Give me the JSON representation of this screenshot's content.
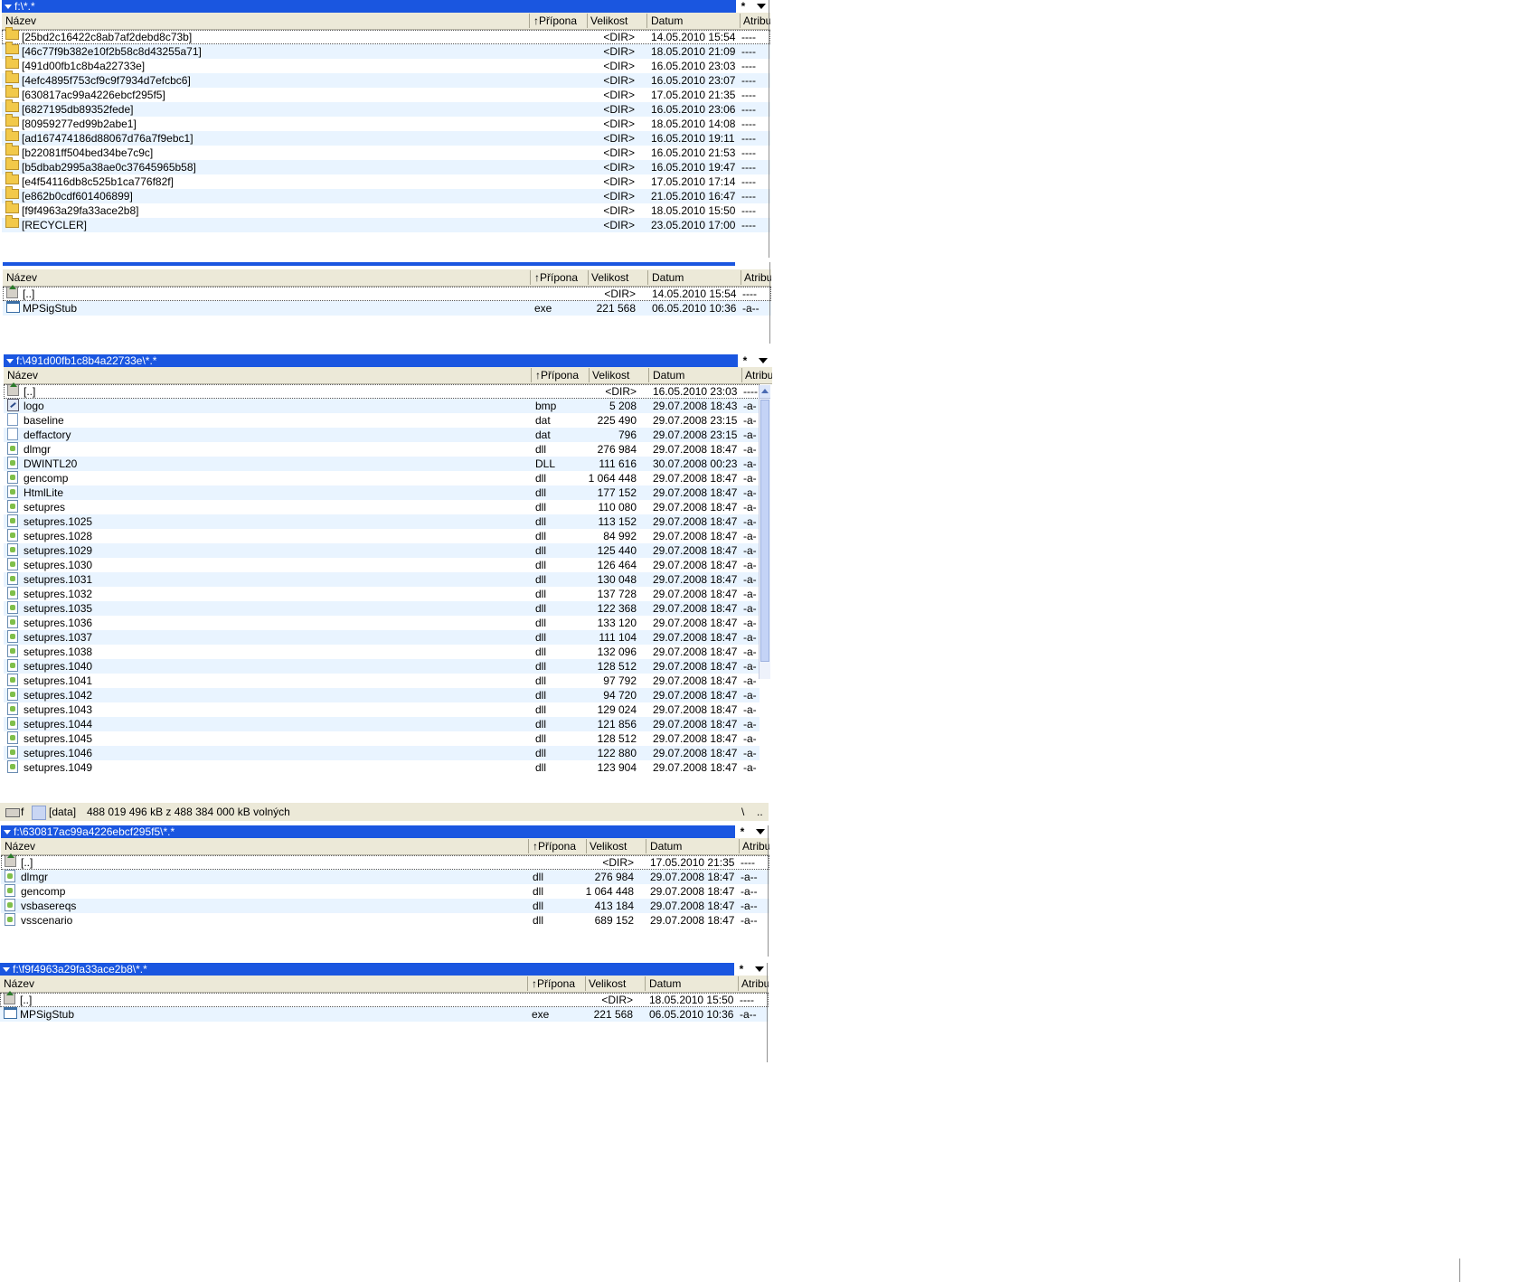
{
  "columns": {
    "name": "Název",
    "ext": "Přípona",
    "size": "Velikost",
    "date": "Datum",
    "attr": "Atribu"
  },
  "sort_indicator": "↑",
  "panel1": {
    "path": "f:\\*.*",
    "star": "*",
    "rows": [
      {
        "name": "[25bd2c16422c8ab7af2debd8c73b]",
        "ext": "",
        "size": "<DIR>",
        "date": "14.05.2010 15:54",
        "attr": "----",
        "icon": "folder-icon"
      },
      {
        "name": "[46c77f9b382e10f2b58c8d43255a71]",
        "ext": "",
        "size": "<DIR>",
        "date": "18.05.2010 21:09",
        "attr": "----",
        "icon": "folder-icon"
      },
      {
        "name": "[491d00fb1c8b4a22733e]",
        "ext": "",
        "size": "<DIR>",
        "date": "16.05.2010 23:03",
        "attr": "----",
        "icon": "folder-icon"
      },
      {
        "name": "[4efc4895f753cf9c9f7934d7efcbc6]",
        "ext": "",
        "size": "<DIR>",
        "date": "16.05.2010 23:07",
        "attr": "----",
        "icon": "folder-icon"
      },
      {
        "name": "[630817ac99a4226ebcf295f5]",
        "ext": "",
        "size": "<DIR>",
        "date": "17.05.2010 21:35",
        "attr": "----",
        "icon": "folder-icon"
      },
      {
        "name": "[6827195db89352fede]",
        "ext": "",
        "size": "<DIR>",
        "date": "16.05.2010 23:06",
        "attr": "----",
        "icon": "folder-icon"
      },
      {
        "name": "[80959277ed99b2abe1]",
        "ext": "",
        "size": "<DIR>",
        "date": "18.05.2010 14:08",
        "attr": "----",
        "icon": "folder-icon"
      },
      {
        "name": "[ad167474186d88067d76a7f9ebc1]",
        "ext": "",
        "size": "<DIR>",
        "date": "16.05.2010 19:11",
        "attr": "----",
        "icon": "folder-icon"
      },
      {
        "name": "[b22081ff504bed34be7c9c]",
        "ext": "",
        "size": "<DIR>",
        "date": "16.05.2010 21:53",
        "attr": "----",
        "icon": "folder-icon"
      },
      {
        "name": "[b5dbab2995a38ae0c37645965b58]",
        "ext": "",
        "size": "<DIR>",
        "date": "16.05.2010 19:47",
        "attr": "----",
        "icon": "folder-icon"
      },
      {
        "name": "[e4f54116db8c525b1ca776f82f]",
        "ext": "",
        "size": "<DIR>",
        "date": "17.05.2010 17:14",
        "attr": "----",
        "icon": "folder-icon"
      },
      {
        "name": "[e862b0cdf601406899]",
        "ext": "",
        "size": "<DIR>",
        "date": "21.05.2010 16:47",
        "attr": "----",
        "icon": "folder-icon"
      },
      {
        "name": "[f9f4963a29fa33ace2b8]",
        "ext": "",
        "size": "<DIR>",
        "date": "18.05.2010 15:50",
        "attr": "----",
        "icon": "folder-icon"
      },
      {
        "name": "[RECYCLER]",
        "ext": "",
        "size": "<DIR>",
        "date": "23.05.2010 17:00",
        "attr": "----",
        "icon": "folder-icon"
      }
    ]
  },
  "panel2": {
    "rows": [
      {
        "name": "[..]",
        "ext": "",
        "size": "<DIR>",
        "date": "14.05.2010 15:54",
        "attr": "----",
        "icon": "up-dir-icon"
      },
      {
        "name": "MPSigStub",
        "ext": "exe",
        "size": "221 568",
        "date": "06.05.2010 10:36",
        "attr": "-a--",
        "icon": "exe-icon"
      }
    ]
  },
  "panel3": {
    "path": "f:\\491d00fb1c8b4a22733e\\*.*",
    "star": "*",
    "rows": [
      {
        "name": "[..]",
        "ext": "",
        "size": "<DIR>",
        "date": "16.05.2010 23:03",
        "attr": "----",
        "icon": "up-dir-icon"
      },
      {
        "name": "logo",
        "ext": "bmp",
        "size": "5 208",
        "date": "29.07.2008 18:43",
        "attr": "-a-",
        "icon": "bmp-icon"
      },
      {
        "name": "baseline",
        "ext": "dat",
        "size": "225 490",
        "date": "29.07.2008 23:15",
        "attr": "-a-",
        "icon": "doc-icon"
      },
      {
        "name": "deffactory",
        "ext": "dat",
        "size": "796",
        "date": "29.07.2008 23:15",
        "attr": "-a-",
        "icon": "doc-icon"
      },
      {
        "name": "dlmgr",
        "ext": "dll",
        "size": "276 984",
        "date": "29.07.2008 18:47",
        "attr": "-a-",
        "icon": "dll-icon"
      },
      {
        "name": "DWINTL20",
        "ext": "DLL",
        "size": "111 616",
        "date": "30.07.2008 00:23",
        "attr": "-a-",
        "icon": "dll-icon"
      },
      {
        "name": "gencomp",
        "ext": "dll",
        "size": "1 064 448",
        "date": "29.07.2008 18:47",
        "attr": "-a-",
        "icon": "dll-icon"
      },
      {
        "name": "HtmlLite",
        "ext": "dll",
        "size": "177 152",
        "date": "29.07.2008 18:47",
        "attr": "-a-",
        "icon": "dll-icon"
      },
      {
        "name": "setupres",
        "ext": "dll",
        "size": "110 080",
        "date": "29.07.2008 18:47",
        "attr": "-a-",
        "icon": "dll-icon"
      },
      {
        "name": "setupres.1025",
        "ext": "dll",
        "size": "113 152",
        "date": "29.07.2008 18:47",
        "attr": "-a-",
        "icon": "dll-icon"
      },
      {
        "name": "setupres.1028",
        "ext": "dll",
        "size": "84 992",
        "date": "29.07.2008 18:47",
        "attr": "-a-",
        "icon": "dll-icon"
      },
      {
        "name": "setupres.1029",
        "ext": "dll",
        "size": "125 440",
        "date": "29.07.2008 18:47",
        "attr": "-a-",
        "icon": "dll-icon"
      },
      {
        "name": "setupres.1030",
        "ext": "dll",
        "size": "126 464",
        "date": "29.07.2008 18:47",
        "attr": "-a-",
        "icon": "dll-icon"
      },
      {
        "name": "setupres.1031",
        "ext": "dll",
        "size": "130 048",
        "date": "29.07.2008 18:47",
        "attr": "-a-",
        "icon": "dll-icon"
      },
      {
        "name": "setupres.1032",
        "ext": "dll",
        "size": "137 728",
        "date": "29.07.2008 18:47",
        "attr": "-a-",
        "icon": "dll-icon"
      },
      {
        "name": "setupres.1035",
        "ext": "dll",
        "size": "122 368",
        "date": "29.07.2008 18:47",
        "attr": "-a-",
        "icon": "dll-icon"
      },
      {
        "name": "setupres.1036",
        "ext": "dll",
        "size": "133 120",
        "date": "29.07.2008 18:47",
        "attr": "-a-",
        "icon": "dll-icon"
      },
      {
        "name": "setupres.1037",
        "ext": "dll",
        "size": "111 104",
        "date": "29.07.2008 18:47",
        "attr": "-a-",
        "icon": "dll-icon"
      },
      {
        "name": "setupres.1038",
        "ext": "dll",
        "size": "132 096",
        "date": "29.07.2008 18:47",
        "attr": "-a-",
        "icon": "dll-icon"
      },
      {
        "name": "setupres.1040",
        "ext": "dll",
        "size": "128 512",
        "date": "29.07.2008 18:47",
        "attr": "-a-",
        "icon": "dll-icon"
      },
      {
        "name": "setupres.1041",
        "ext": "dll",
        "size": "97 792",
        "date": "29.07.2008 18:47",
        "attr": "-a-",
        "icon": "dll-icon"
      },
      {
        "name": "setupres.1042",
        "ext": "dll",
        "size": "94 720",
        "date": "29.07.2008 18:47",
        "attr": "-a-",
        "icon": "dll-icon"
      },
      {
        "name": "setupres.1043",
        "ext": "dll",
        "size": "129 024",
        "date": "29.07.2008 18:47",
        "attr": "-a-",
        "icon": "dll-icon"
      },
      {
        "name": "setupres.1044",
        "ext": "dll",
        "size": "121 856",
        "date": "29.07.2008 18:47",
        "attr": "-a-",
        "icon": "dll-icon"
      },
      {
        "name": "setupres.1045",
        "ext": "dll",
        "size": "128 512",
        "date": "29.07.2008 18:47",
        "attr": "-a-",
        "icon": "dll-icon"
      },
      {
        "name": "setupres.1046",
        "ext": "dll",
        "size": "122 880",
        "date": "29.07.2008 18:47",
        "attr": "-a-",
        "icon": "dll-icon"
      },
      {
        "name": "setupres.1049",
        "ext": "dll",
        "size": "123 904",
        "date": "29.07.2008 18:47",
        "attr": "-a-",
        "icon": "dll-icon"
      }
    ]
  },
  "drivebar": {
    "drive_letter": "f",
    "label": "[data]",
    "free_text": "488 019 496 kB z 488 384 000 kB volných",
    "root_btn": "\\",
    "up_btn": ".."
  },
  "panel4": {
    "path": "f:\\630817ac99a4226ebcf295f5\\*.*",
    "star": "*",
    "rows": [
      {
        "name": "[..]",
        "ext": "",
        "size": "<DIR>",
        "date": "17.05.2010 21:35",
        "attr": "----",
        "icon": "up-dir-icon"
      },
      {
        "name": "dlmgr",
        "ext": "dll",
        "size": "276 984",
        "date": "29.07.2008 18:47",
        "attr": "-a--",
        "icon": "dll-icon"
      },
      {
        "name": "gencomp",
        "ext": "dll",
        "size": "1 064 448",
        "date": "29.07.2008 18:47",
        "attr": "-a--",
        "icon": "dll-icon"
      },
      {
        "name": "vsbasereqs",
        "ext": "dll",
        "size": "413 184",
        "date": "29.07.2008 18:47",
        "attr": "-a--",
        "icon": "dll-icon"
      },
      {
        "name": "vsscenario",
        "ext": "dll",
        "size": "689 152",
        "date": "29.07.2008 18:47",
        "attr": "-a--",
        "icon": "dll-icon"
      }
    ]
  },
  "panel5": {
    "path": "f:\\f9f4963a29fa33ace2b8\\*.*",
    "star": "*",
    "rows": [
      {
        "name": "[..]",
        "ext": "",
        "size": "<DIR>",
        "date": "18.05.2010 15:50",
        "attr": "----",
        "icon": "up-dir-icon"
      },
      {
        "name": "MPSigStub",
        "ext": "exe",
        "size": "221 568",
        "date": "06.05.2010 10:36",
        "attr": "-a--",
        "icon": "exe-icon"
      }
    ]
  },
  "colors": {
    "title_bar": "#1a56e0",
    "row_alt": "#e9f4ff",
    "header_bg": "#ece9d8"
  }
}
